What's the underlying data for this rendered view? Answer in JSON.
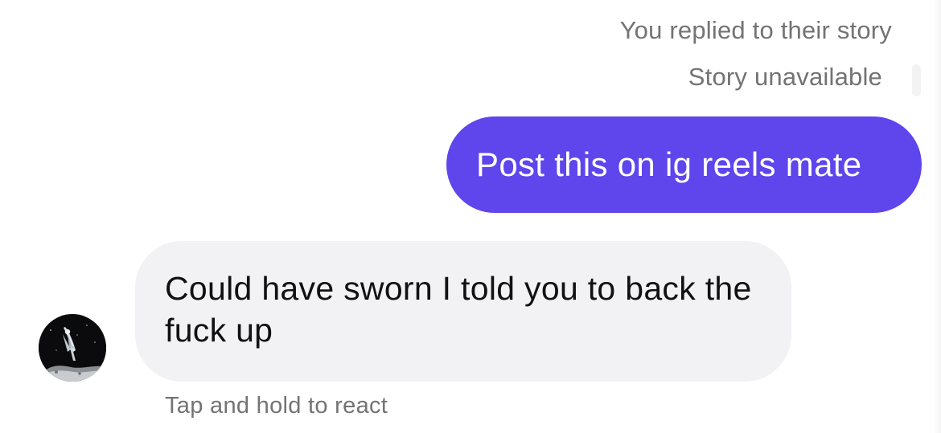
{
  "thread": {
    "reply_note": "You replied to their story",
    "story_status": "Story unavailable",
    "messages": [
      {
        "sender": "me",
        "text": "Post this on ig reels mate",
        "bubble_color": "#5f45ec",
        "text_color": "#ffffff"
      },
      {
        "sender": "them",
        "text": "Could have sworn I told you to back the fuck up",
        "bubble_color": "#f2f2f4",
        "text_color": "#111111"
      }
    ],
    "react_hint": "Tap and hold to react"
  },
  "contact": {
    "avatar_icon": "astronaut-surfboard-avatar"
  },
  "colors": {
    "meta_text": "#737373",
    "background": "#ffffff"
  }
}
